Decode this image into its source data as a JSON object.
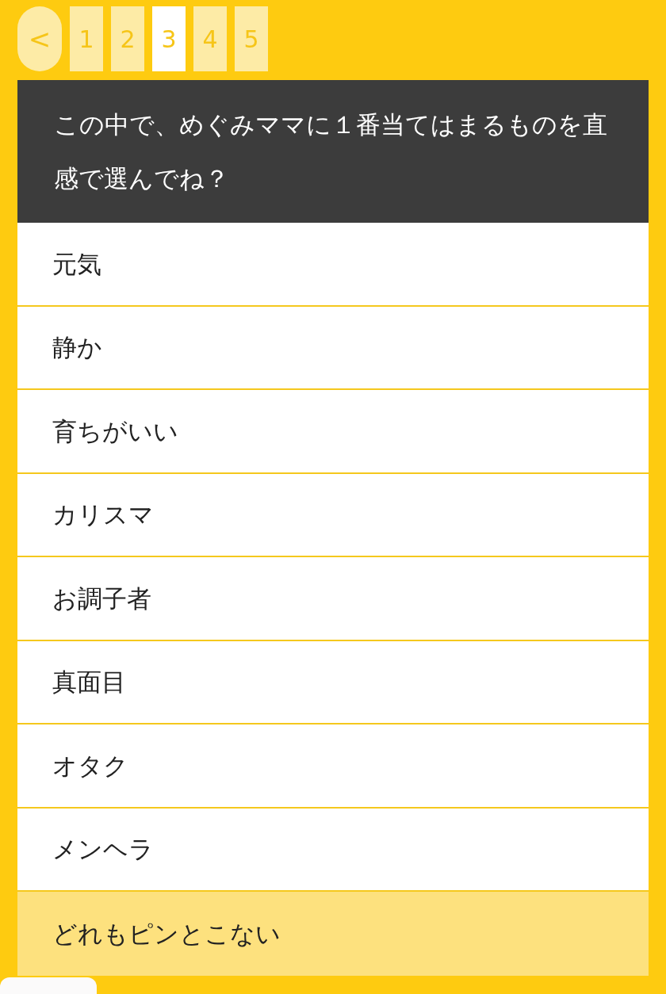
{
  "pager": {
    "back": "<",
    "pages": [
      {
        "label": "1",
        "selected": false
      },
      {
        "label": "2",
        "selected": false
      },
      {
        "label": "3",
        "selected": true
      },
      {
        "label": "4",
        "selected": false
      },
      {
        "label": "5",
        "selected": false
      }
    ]
  },
  "question": "この中で、めぐみママに１番当てはまるものを直感で選んでね？",
  "options": [
    {
      "label": "元気",
      "kind": "answer"
    },
    {
      "label": "静か",
      "kind": "answer"
    },
    {
      "label": "育ちがいい",
      "kind": "answer"
    },
    {
      "label": "カリスマ",
      "kind": "answer"
    },
    {
      "label": "お調子者",
      "kind": "answer"
    },
    {
      "label": "真面目",
      "kind": "answer"
    },
    {
      "label": "オタク",
      "kind": "answer"
    },
    {
      "label": "メンヘラ",
      "kind": "answer"
    },
    {
      "label": "どれもピンとこない",
      "kind": "none"
    }
  ]
}
